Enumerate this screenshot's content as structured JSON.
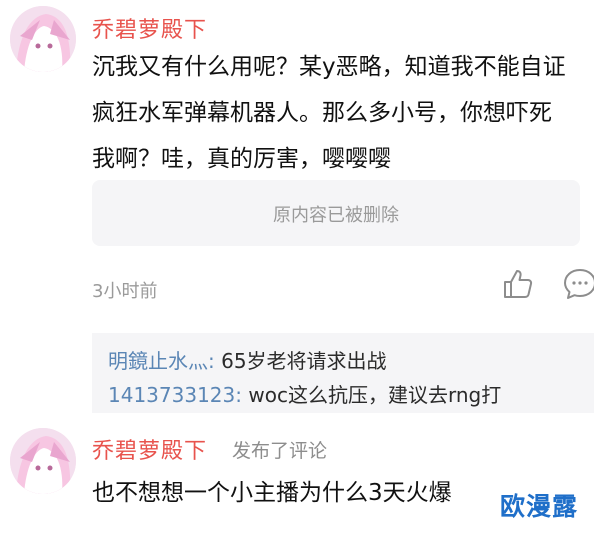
{
  "comment1": {
    "username": "乔碧萝殿下",
    "lines": [
      "沉我又有什么用呢？某y恶略，知道我不能自证",
      "疯狂水军弹幕机器人。那么多小号，你想吓死",
      "我啊？哇，真的厉害，嘤嘤嘤"
    ],
    "quoted": "原内容已被删除",
    "time": "3小时前",
    "like_icon": "thumbs-up-icon",
    "reply_icon": "comment-bubble-icon",
    "replies": [
      {
        "user": "明鏡止水灬",
        "sep": ": ",
        "text": "65岁老将请求出战"
      },
      {
        "user": "1413733123",
        "sep": ": ",
        "text": "woc这么抗压，建议去rng打"
      }
    ]
  },
  "comment2": {
    "username": "乔碧萝殿下",
    "action": "发布了评论",
    "line": "也不想想一个小主播为什么3天火爆"
  },
  "watermark": "欧漫露",
  "colors": {
    "username": "#e8534d",
    "reply_user": "#5b86b5",
    "watermark": "#1f6fc9"
  }
}
